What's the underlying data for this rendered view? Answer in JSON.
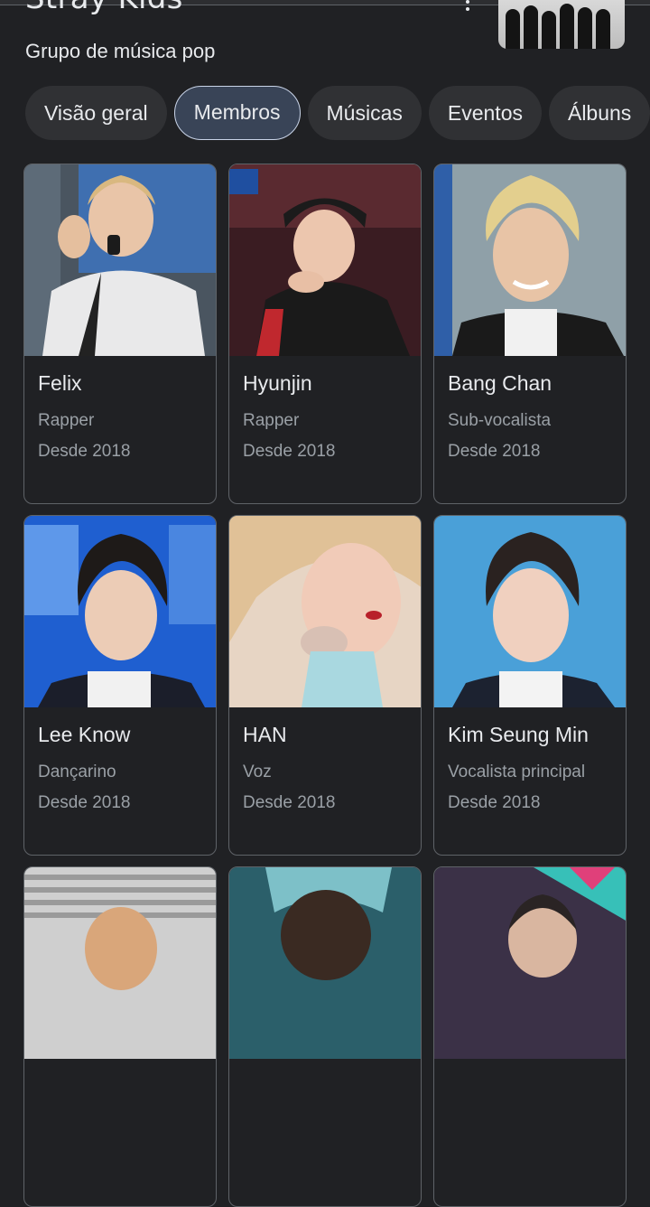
{
  "entity": {
    "title": "Stray Kids",
    "subtitle": "Grupo de música pop"
  },
  "icons": {
    "menu": "more-vert-icon"
  },
  "chips": [
    {
      "label": "Visão geral",
      "selected": false
    },
    {
      "label": "Membros",
      "selected": true
    },
    {
      "label": "Músicas",
      "selected": false
    },
    {
      "label": "Eventos",
      "selected": false
    },
    {
      "label": "Álbuns",
      "selected": false
    }
  ],
  "members": [
    {
      "name": "Felix",
      "role": "Rapper",
      "since": "Desde 2018"
    },
    {
      "name": "Hyunjin",
      "role": "Rapper",
      "since": "Desde 2018"
    },
    {
      "name": "Bang Chan",
      "role": "Sub-vocalista",
      "since": "Desde 2018"
    },
    {
      "name": "Lee Know",
      "role": "Dançarino",
      "since": "Desde 2018"
    },
    {
      "name": "HAN",
      "role": "Voz",
      "since": "Desde 2018"
    },
    {
      "name": "Kim Seung Min",
      "role": "Vocalista principal",
      "since": "Desde 2018"
    },
    {
      "name": "",
      "role": "",
      "since": ""
    },
    {
      "name": "",
      "role": "",
      "since": ""
    },
    {
      "name": "",
      "role": "",
      "since": ""
    }
  ],
  "colors": {
    "background": "#202124",
    "chip": "#303134",
    "chip_selected": "#394457",
    "text_primary": "#e8eaed",
    "text_secondary": "#9aa0a6",
    "card_border": "#5f6368"
  }
}
